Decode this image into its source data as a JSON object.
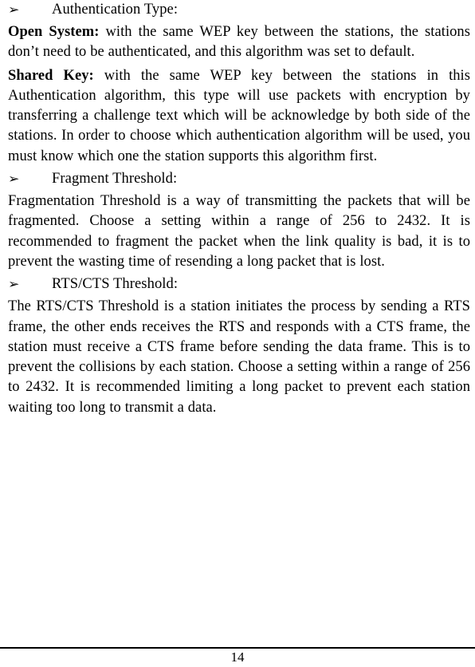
{
  "document": {
    "type": "user-manual-page",
    "page_number": "14",
    "background_color": "#ffffff",
    "text_color": "#000000",
    "bullet_glyph": "➢",
    "bullet_icon_name": "arrowhead-bullet-icon"
  },
  "sections": [
    {
      "id": "authentication-type",
      "heading": "Authentication Type:",
      "paragraphs": [
        {
          "id": "open-system",
          "lead_in": "Open System:",
          "body": " with the same WEP key between the stations, the stations don’t need to be authenticated, and this algorithm was set to default."
        },
        {
          "id": "shared-key",
          "lead_in": "Shared Key:",
          "body": " with the same WEP key between the stations in this Authentication algorithm, this type will use packets with encryption by transferring a challenge text which will be acknowledge by both side of the stations. In order to choose which authentication algorithm will be used, you must know which one the station supports this algorithm first."
        }
      ]
    },
    {
      "id": "fragment-threshold",
      "heading": "Fragment Threshold:",
      "paragraphs": [
        {
          "id": "fragment-threshold-body",
          "lead_in": "",
          "body": "Fragmentation Threshold is a way of transmitting the packets that will be fragmented. Choose a setting within a range of 256 to 2432. It is recommended to fragment the packet when the link quality is bad, it is to prevent the wasting time of resending a long packet that is lost."
        }
      ]
    },
    {
      "id": "rts-cts-threshold",
      "heading": "RTS/CTS Threshold:",
      "paragraphs": [
        {
          "id": "rts-cts-threshold-body",
          "lead_in": "",
          "body": "The RTS/CTS Threshold is a station initiates the process by sending a RTS frame, the other ends receives the RTS and responds with a CTS frame, the station must receive a CTS frame before sending the data frame. This is to prevent the collisions by each station. Choose a setting within a range of 256 to 2432. It is recommended limiting a long packet to prevent each station waiting too long to transmit a data."
        }
      ]
    }
  ],
  "footer": {
    "page_number": "14"
  }
}
